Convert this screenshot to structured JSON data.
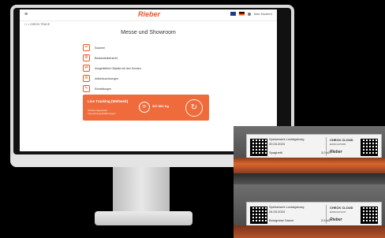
{
  "screen": {
    "menu_icon": "≡",
    "logo": "Rieber",
    "top_right": {
      "user_label": "Max Mustern"
    },
    "breadcrumb": "☖  >  CHECK TRACE",
    "title": "Messe und Showroom",
    "menu_items": [
      {
        "label": "Scanner",
        "icon": "scanner-icon",
        "glyph": "⌗"
      },
      {
        "label": "Bestandsübersicht",
        "icon": "inventory-icon",
        "glyph": "≣"
      },
      {
        "label": "Ausgelieferte Objekte mit den Kunden",
        "icon": "delivery-icon",
        "glyph": "⇄"
      },
      {
        "label": "Artikelzuordnungen",
        "icon": "articles-icon",
        "glyph": "⚙"
      },
      {
        "label": "Einstellungen",
        "icon": "settings-icon",
        "glyph": "✎"
      }
    ],
    "tracking": {
      "title": "Live Tracking (Weltweit)",
      "subtitle": "Global eingesparte Verpackungsabfallmengen",
      "weight": "357.560 Kg",
      "accent": "#ef6b3b"
    }
  },
  "photo": {
    "labels": [
      {
        "product": "Speisewerk Ludwigsburg",
        "date": "20.03.2024",
        "item": "Spaghetti",
        "number": "3,0 kG",
        "check": "CHECK CLOUD",
        "code": "EW0C1470465",
        "brand": "Rieber"
      },
      {
        "product": "Speisewerk Ludwigsburg",
        "date": "24.03.2024",
        "item": "Bolognese Sauce",
        "number": "2,5 kG",
        "check": "CHECK CLOUD",
        "code": "EW0C1471447",
        "brand": "Rieber"
      }
    ]
  }
}
